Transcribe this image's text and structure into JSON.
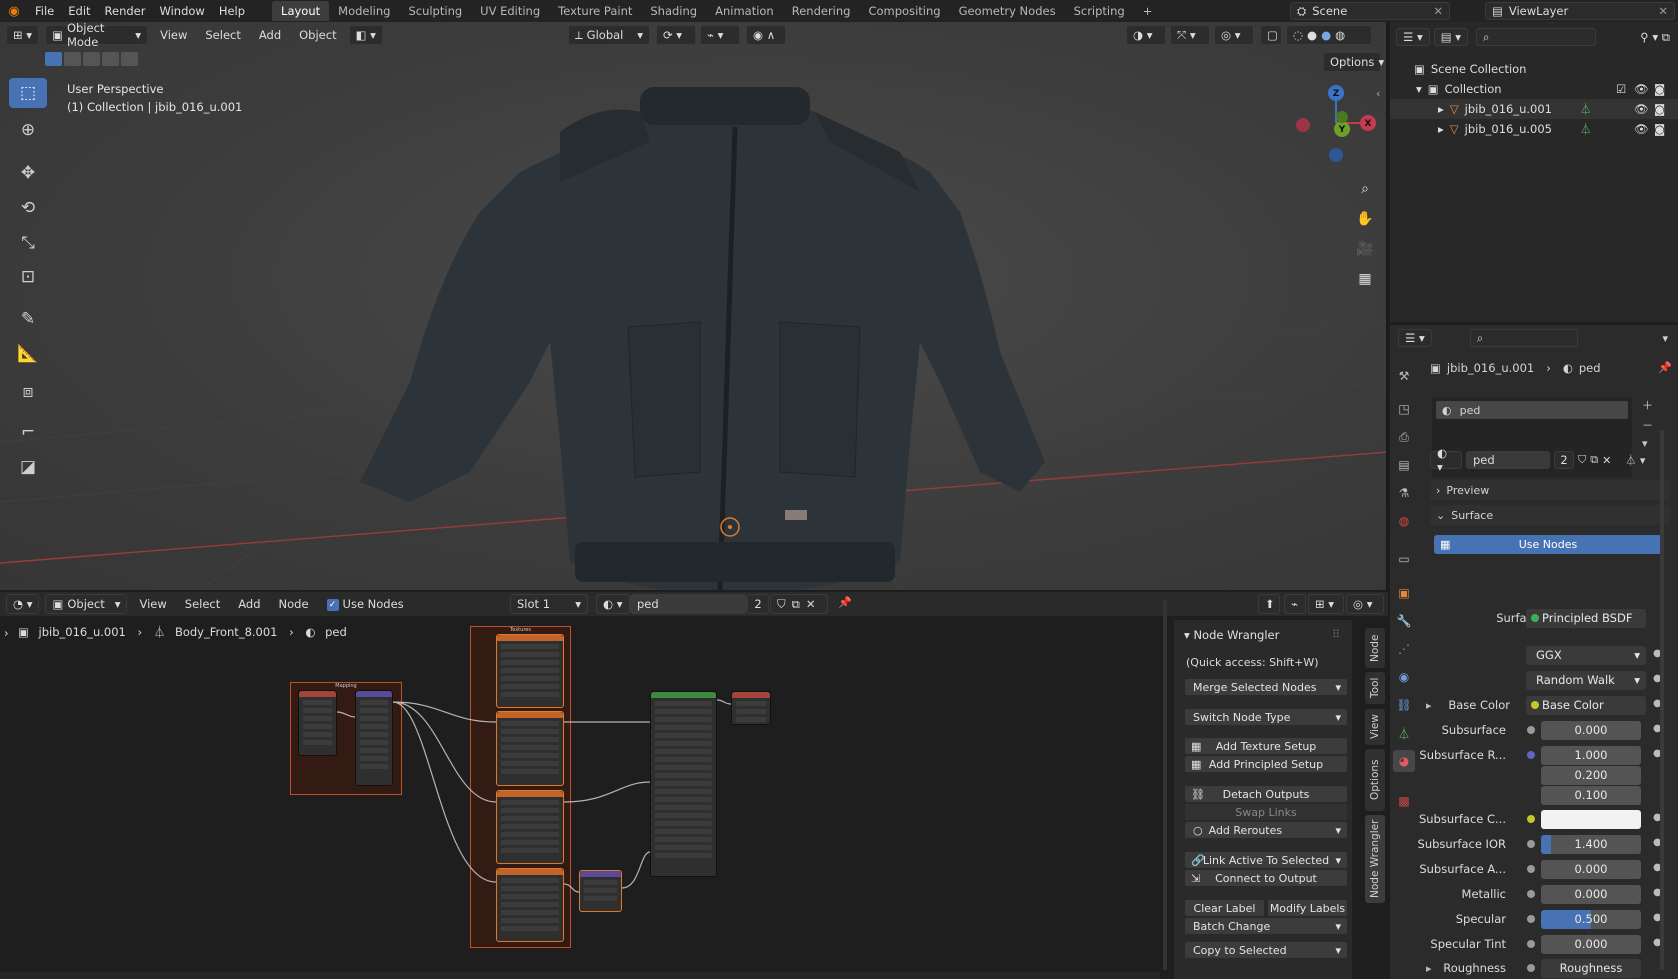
{
  "topbar": {
    "menus": [
      "File",
      "Edit",
      "Render",
      "Window",
      "Help"
    ],
    "workspaces": [
      "Layout",
      "Modeling",
      "Sculpting",
      "UV Editing",
      "Texture Paint",
      "Shading",
      "Animation",
      "Rendering",
      "Compositing",
      "Geometry Nodes",
      "Scripting",
      "+"
    ],
    "active_workspace": "Layout",
    "scene": "Scene",
    "view_layer": "ViewLayer"
  },
  "viewport": {
    "mode": "Object Mode",
    "menus": [
      "View",
      "Select",
      "Add",
      "Object"
    ],
    "transform_orientation": "Global",
    "options_label": "Options",
    "perspective_label": "User Perspective",
    "collection_label": "(1) Collection | jbib_016_u.001",
    "gizmo_axes": {
      "x": "X",
      "y": "Y",
      "z": "Z"
    }
  },
  "node_editor": {
    "editor_type": "Object",
    "menus": [
      "View",
      "Select",
      "Add",
      "Node"
    ],
    "use_nodes_label": "Use Nodes",
    "slot": "Slot 1",
    "material": "ped",
    "users": "2",
    "breadcrumb": [
      "jbib_016_u.001",
      "Body_Front_8.001",
      "ped"
    ],
    "frames": {
      "mapping": "Mapping",
      "textures": "Textures"
    }
  },
  "node_wrangler": {
    "title": "Node Wrangler",
    "quick_access": "(Quick access: Shift+W)",
    "merge": "Merge Selected Nodes",
    "switch": "Switch Node Type",
    "add_texture": "Add Texture Setup",
    "add_principled": "Add Principled Setup",
    "detach": "Detach Outputs",
    "swap": "Swap Links",
    "add_reroutes": "Add Reroutes",
    "link_active": "Link Active To Selected",
    "connect_output": "Connect to Output",
    "clear_label": "Clear Label",
    "modify_labels": "Modify Labels",
    "batch_change": "Batch Change",
    "copy_selected": "Copy to Selected",
    "side_tabs": [
      "Node",
      "Tool",
      "View",
      "Options",
      "Node Wrangler"
    ]
  },
  "outliner": {
    "scene_collection": "Scene Collection",
    "collection": "Collection",
    "objects": [
      "jbib_016_u.001",
      "jbib_016_u.005"
    ]
  },
  "properties": {
    "object": "jbib_016_u.001",
    "material": "ped",
    "slot_item": "ped",
    "material_field": "ped",
    "users": "2",
    "preview": "Preview",
    "surface_panel": "Surface",
    "use_nodes": "Use Nodes",
    "surface_label": "Surface",
    "surface_value": "Principled BSDF",
    "distribution": "GGX",
    "subsurface_method": "Random Walk",
    "rows": [
      {
        "label": "Base Color",
        "value": "Base Color"
      },
      {
        "label": "Subsurface",
        "value": "0.000"
      },
      {
        "label": "Subsurface R...",
        "value": "1.000"
      },
      {
        "label": "",
        "value": "0.200"
      },
      {
        "label": "",
        "value": "0.100"
      },
      {
        "label": "Subsurface C...",
        "value": ""
      },
      {
        "label": "Subsurface IOR",
        "value": "1.400"
      },
      {
        "label": "Subsurface A...",
        "value": "0.000"
      },
      {
        "label": "Metallic",
        "value": "0.000"
      },
      {
        "label": "Specular",
        "value": "0.500"
      },
      {
        "label": "Specular Tint",
        "value": "0.000"
      },
      {
        "label": "Roughness",
        "value": "Roughness"
      }
    ],
    "colors": {
      "accent": "#4772b3",
      "subsurface_color": "#f2f2f2"
    }
  }
}
